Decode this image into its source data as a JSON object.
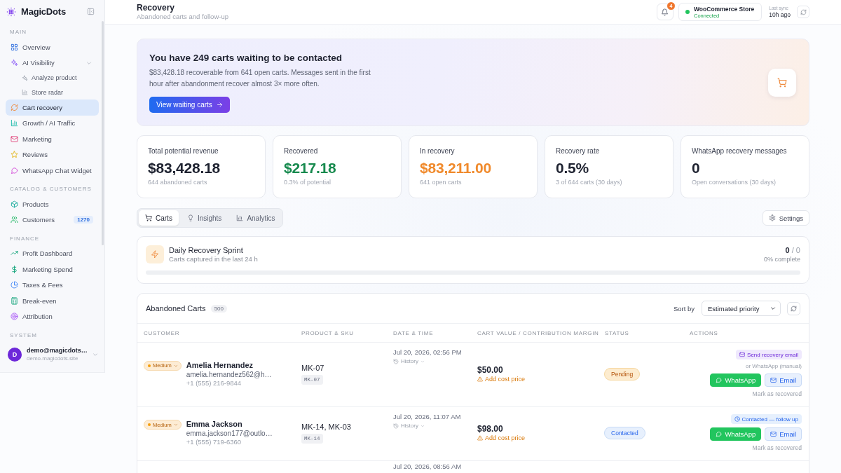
{
  "sidebar": {
    "logo": "MagicDots",
    "sections": [
      {
        "title": "MAIN",
        "items": [
          {
            "label": "Overview",
            "selected": false
          },
          {
            "label": "AI Visibility",
            "selected": false,
            "expanded": true,
            "children": [
              {
                "label": "Analyze product",
                "selected": false
              },
              {
                "label": "Store radar",
                "selected": false
              }
            ]
          },
          {
            "label": "Cart recovery",
            "selected": true
          },
          {
            "label": "Growth / AI Traffic",
            "selected": false
          },
          {
            "label": "Marketing",
            "selected": false
          },
          {
            "label": "Reviews",
            "selected": false
          },
          {
            "label": "WhatsApp Chat Widget",
            "selected": false
          }
        ]
      },
      {
        "title": "CATALOG & CUSTOMERS",
        "items": [
          {
            "label": "Products",
            "selected": false
          },
          {
            "label": "Customers",
            "selected": false,
            "badge": "1270"
          }
        ]
      },
      {
        "title": "FINANCE",
        "items": [
          {
            "label": "Profit Dashboard",
            "selected": false
          },
          {
            "label": "Marketing Spend",
            "selected": false
          },
          {
            "label": "Taxes & Fees",
            "selected": false
          },
          {
            "label": "Break-even",
            "selected": false
          },
          {
            "label": "Attribution",
            "selected": false
          }
        ]
      },
      {
        "title": "SYSTEM"
      }
    ],
    "user": {
      "avatar": "D",
      "email": "demo@magicdots…",
      "site": "demo.magicdots.site"
    }
  },
  "header": {
    "title": "Recovery",
    "subtitle": "Abandoned carts and follow-up",
    "notifications": "4",
    "store": {
      "name": "WooCommerce Store",
      "status": "Connected",
      "connected": true
    },
    "sync": {
      "label": "Last sync",
      "time": "10h ago"
    }
  },
  "banner": {
    "title": "You have 249 carts waiting to be contacted",
    "text": "$83,428.18 recoverable from 641 open carts. Messages sent in the first hour after abandonment recover almost 3× more often.",
    "button": "View waiting carts"
  },
  "stats": [
    {
      "label": "Total potential revenue",
      "value": "$83,428.18",
      "sub": "644 abandoned carts",
      "color": "#1e2230"
    },
    {
      "label": "Recovered",
      "value": "$217.18",
      "sub": "0.3% of potential",
      "color": "#178a4e"
    },
    {
      "label": "In recovery",
      "value": "$83,211.00",
      "sub": "641 open carts",
      "color": "#f08a2c"
    },
    {
      "label": "Recovery rate",
      "value": "0.5%",
      "sub": "3 of 644 carts (30 days)",
      "color": "#1e2230"
    },
    {
      "label": "WhatsApp recovery messages",
      "value": "0",
      "sub": "Open conversations (30 days)",
      "color": "#1e2230"
    }
  ],
  "tabs": [
    {
      "label": "Carts",
      "selected": true
    },
    {
      "label": "Insights",
      "selected": false
    },
    {
      "label": "Analytics",
      "selected": false
    }
  ],
  "settings_button": "Settings",
  "sprint": {
    "title": "Daily Recovery Sprint",
    "subtitle": "Carts captured in the last 24 h",
    "count": "**0** / 0",
    "progress_label": "0% complete",
    "level": 0
  },
  "table": {
    "title": "Abandoned Carts",
    "count": "500",
    "sort_label": "Sort by",
    "sort_value": "Estimated priority",
    "columns": [
      "CUSTOMER",
      "PRODUCT & SKU",
      "DATE & TIME",
      "CART VALUE / CONTRIBUTION MARGIN",
      "STATUS",
      "ACTIONS"
    ],
    "rows": [
      {
        "priority": {
          "label": "Medium",
          "kind": "medium"
        },
        "name": "Amelia Hernandez",
        "email": "amelia.hernandez562@h…",
        "phone": "+1 (555) 216-9844",
        "products": "MK-07",
        "sku": "MK-07",
        "date": "Jul 20, 2026, 02:56 PM",
        "history": "History",
        "value": "$50.00",
        "cost_hint": "Add cost price",
        "status": {
          "label": "Pending",
          "kind": "pending"
        },
        "suggestion": {
          "label": "Send recovery email",
          "kind": "email"
        },
        "alt_hint": "or WhatsApp (manual)",
        "buttons": [
          {
            "label": "WhatsApp",
            "kind": "whatsapp"
          },
          {
            "label": "Email",
            "kind": "email"
          }
        ],
        "mark_link": "Mark as recovered"
      },
      {
        "priority": {
          "label": "Medium",
          "kind": "medium"
        },
        "name": "Emma Jackson",
        "email": "emma.jackson177@outlo…",
        "phone": "+1 (555) 719-6360",
        "products": "MK-14, MK-03",
        "sku": "MK-14",
        "date": "Jul 20, 2026, 11:07 AM",
        "history": "History",
        "value": "$98.00",
        "cost_hint": "Add cost price",
        "status": {
          "label": "Contacted",
          "kind": "contacted"
        },
        "suggestion": {
          "label": "Contacted — follow up",
          "kind": "follow_up"
        },
        "buttons": [
          {
            "label": "WhatsApp",
            "kind": "whatsapp"
          },
          {
            "label": "Email",
            "kind": "email"
          }
        ],
        "mark_link": "Mark as recovered"
      },
      {
        "date": "Jul 20, 2026, 08:56 AM"
      }
    ]
  }
}
